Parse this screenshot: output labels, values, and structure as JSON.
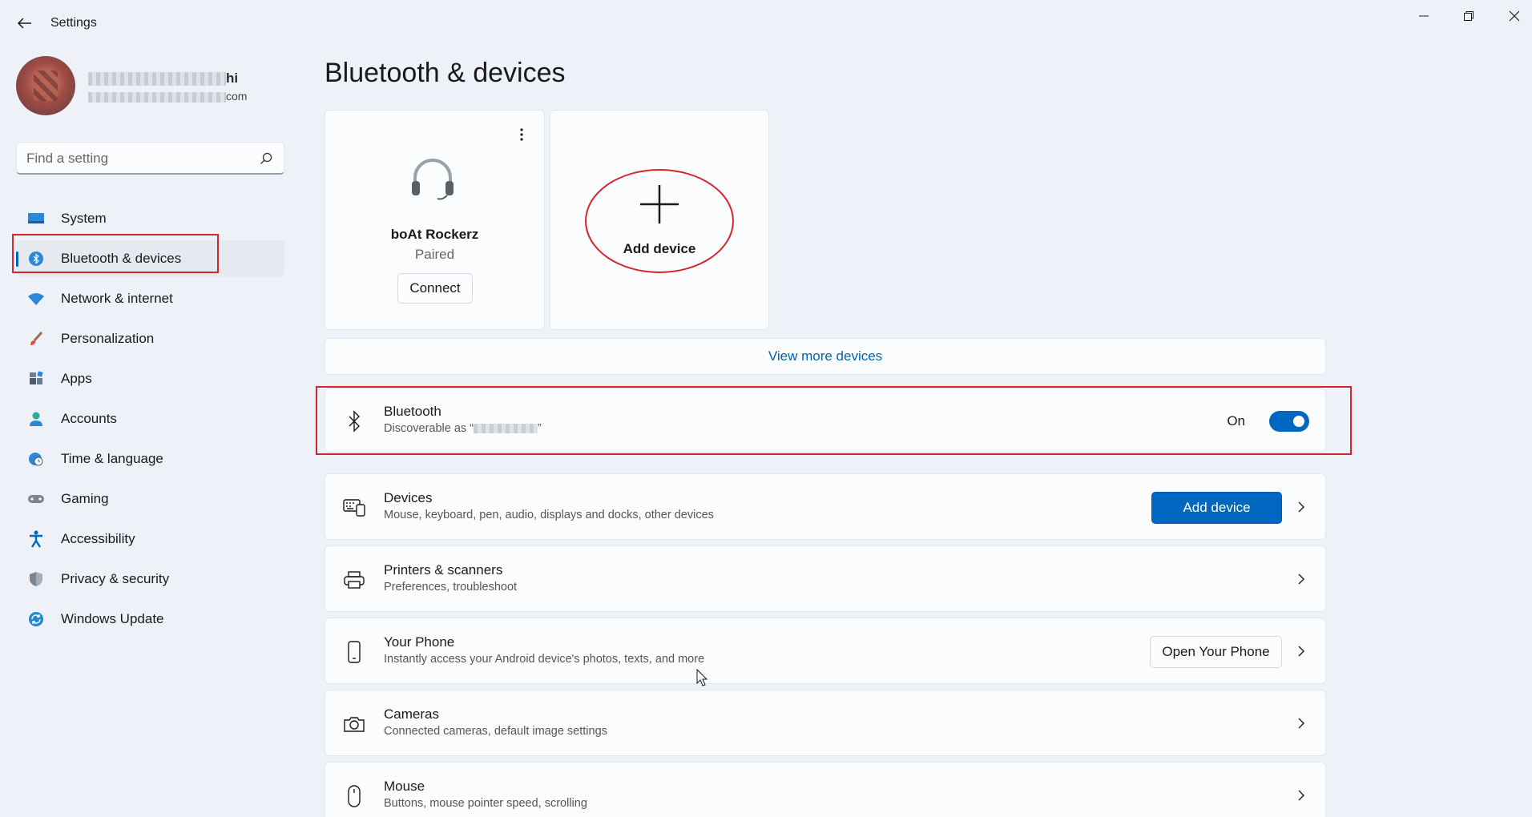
{
  "window": {
    "title": "Settings",
    "back_icon": "back-arrow-icon",
    "controls": [
      "minimize-icon",
      "restore-icon",
      "close-icon"
    ]
  },
  "profile": {
    "name_suffix": "hi",
    "email_suffix": "com"
  },
  "search": {
    "placeholder": "Find a setting"
  },
  "nav": {
    "items": [
      {
        "label": "System",
        "icon": "system-icon"
      },
      {
        "label": "Bluetooth & devices",
        "icon": "bluetooth-icon",
        "selected": true
      },
      {
        "label": "Network & internet",
        "icon": "wifi-icon"
      },
      {
        "label": "Personalization",
        "icon": "brush-icon"
      },
      {
        "label": "Apps",
        "icon": "apps-icon"
      },
      {
        "label": "Accounts",
        "icon": "person-icon"
      },
      {
        "label": "Time & language",
        "icon": "globe-clock-icon"
      },
      {
        "label": "Gaming",
        "icon": "gamepad-icon"
      },
      {
        "label": "Accessibility",
        "icon": "accessibility-icon"
      },
      {
        "label": "Privacy & security",
        "icon": "shield-icon"
      },
      {
        "label": "Windows Update",
        "icon": "update-icon"
      }
    ]
  },
  "main": {
    "page_title": "Bluetooth & devices",
    "device_card": {
      "name": "boAt Rockerz",
      "status": "Paired",
      "connect_label": "Connect"
    },
    "add_card": {
      "label": "Add device"
    },
    "view_more": "View more devices",
    "bluetooth": {
      "title": "Bluetooth",
      "subtitle_prefix": "Discoverable as “",
      "subtitle_suffix": "”",
      "toggle_label": "On",
      "toggle_on": true
    },
    "rows": [
      {
        "title": "Devices",
        "subtitle": "Mouse, keyboard, pen, audio, displays and docks, other devices",
        "button": "Add device",
        "icon": "keyboard-device-icon"
      },
      {
        "title": "Printers & scanners",
        "subtitle": "Preferences, troubleshoot",
        "icon": "printer-icon"
      },
      {
        "title": "Your Phone",
        "subtitle": "Instantly access your Android device's photos, texts, and more",
        "button": "Open Your Phone",
        "icon": "phone-icon"
      },
      {
        "title": "Cameras",
        "subtitle": "Connected cameras, default image settings",
        "icon": "camera-icon"
      },
      {
        "title": "Mouse",
        "subtitle": "Buttons, mouse pointer speed, scrolling",
        "icon": "mouse-icon"
      }
    ]
  },
  "colors": {
    "accent": "#0067c0",
    "highlight": "#d3262c",
    "background": "#eef2f8"
  }
}
